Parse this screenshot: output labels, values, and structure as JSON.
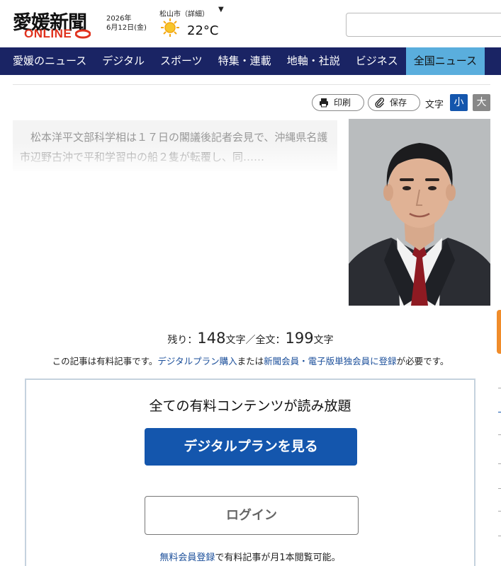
{
  "header": {
    "logo_main": "愛媛新聞",
    "logo_sub": "ONLINE",
    "date_year": "2026年",
    "date_day": "6月12日(金)",
    "weather_city": "松山市（詳細）",
    "weather_caret": "▼",
    "weather_icon": "sun-icon",
    "temperature": "22°C",
    "search_placeholder": ""
  },
  "nav": {
    "items": [
      {
        "label": "愛媛のニュース"
      },
      {
        "label": "デジタル"
      },
      {
        "label": "スポーツ"
      },
      {
        "label": "特集・連載"
      },
      {
        "label": "地軸・社説"
      },
      {
        "label": "ビジネス"
      },
      {
        "label": "全国ニュース"
      }
    ],
    "active_index": 6
  },
  "tools": {
    "print_label": "印刷",
    "save_label": "保存",
    "text_size_label": "文字",
    "size_small": "小",
    "size_large": "大"
  },
  "article": {
    "lead": "松本洋平文部科学相は１７日の閣議後記者会見で、沖縄県名護市辺野古沖で平和学習中の船２隻が転覆し、同……",
    "remaining_prefix": "残り：",
    "remaining_count": "148",
    "remaining_unit": "文字",
    "total_sep": "／全文：",
    "total_count": "199",
    "total_unit": "文字",
    "notice_prefix": "この記事は有料記事です。",
    "notice_link1": "デジタルプラン購入",
    "notice_mid": "または",
    "notice_link2": "新聞会員・電子版単独会員に登録",
    "notice_suffix": "が必要です。"
  },
  "paywall": {
    "heading": "全ての有料コンテンツが読み放題",
    "plan_button": "デジタルプランを見る",
    "login_button": "ログイン",
    "free_link": "無料会員登録",
    "free_suffix": "で有料記事が月1本閲覧可能。"
  },
  "colors": {
    "nav_bg": "#1a2464",
    "nav_active": "#5aaedd",
    "brand_red": "#e0321e",
    "primary_button": "#1456ad",
    "size_small_bg": "#1456ad",
    "size_large_bg": "#888888"
  }
}
